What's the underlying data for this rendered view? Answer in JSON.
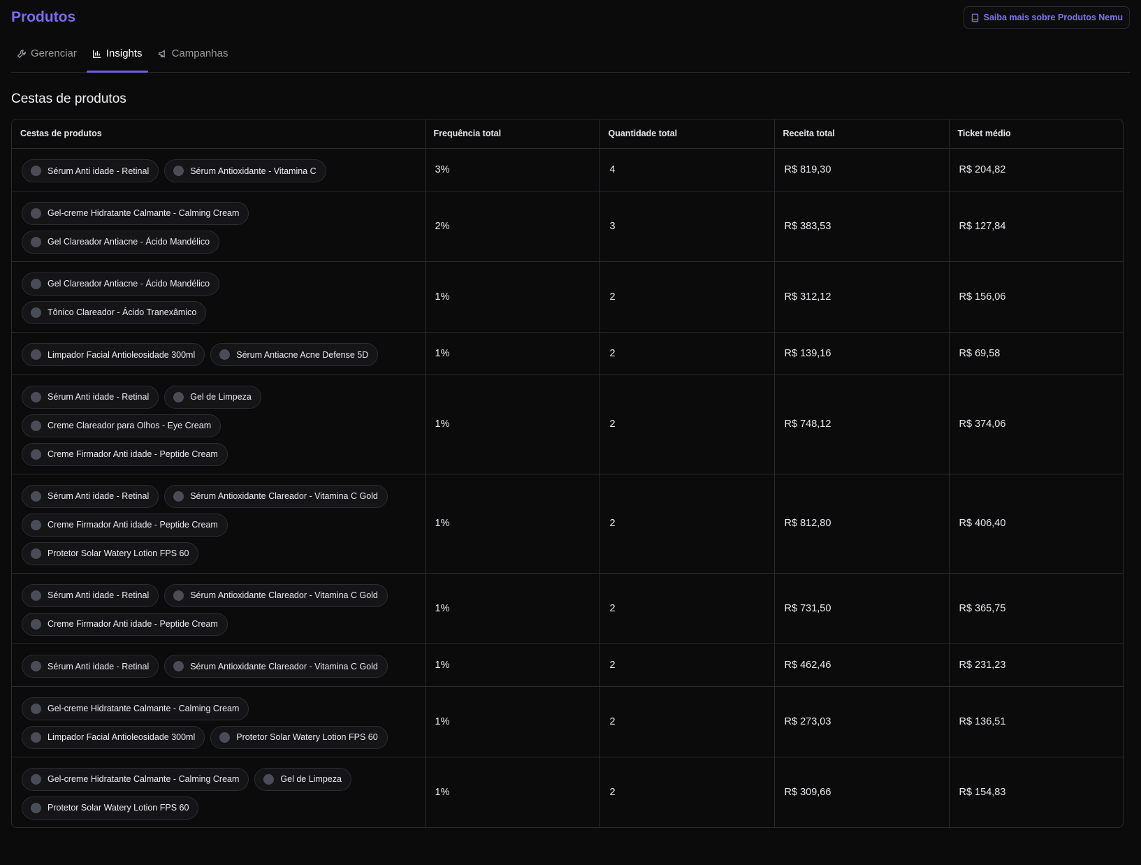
{
  "header": {
    "title": "Produtos",
    "learn_more": "Saiba mais sobre Produtos Nemu"
  },
  "tabs": [
    {
      "label": "Gerenciar",
      "icon": "wrench-icon",
      "active": false
    },
    {
      "label": "Insights",
      "icon": "bar-chart-icon",
      "active": true
    },
    {
      "label": "Campanhas",
      "icon": "megaphone-icon",
      "active": false
    }
  ],
  "section": {
    "title": "Cestas de produtos"
  },
  "colors": {
    "accent": "#7b6cf0",
    "background": "#0b0b0c",
    "border": "#2a2a2f"
  },
  "table": {
    "columns": [
      "Cestas de produtos",
      "Frequência total",
      "Quantidade total",
      "Receita total",
      "Ticket médio"
    ],
    "rows": [
      {
        "products": [
          "Sérum Anti idade - Retinal",
          "Sérum Antioxidante - Vitamina C"
        ],
        "freq": "3%",
        "qty": "4",
        "revenue": "R$ 819,30",
        "ticket": "R$ 204,82"
      },
      {
        "products": [
          "Gel-creme Hidratante Calmante - Calming Cream",
          "Gel Clareador Antiacne - Ácido Mandélico"
        ],
        "freq": "2%",
        "qty": "3",
        "revenue": "R$ 383,53",
        "ticket": "R$ 127,84"
      },
      {
        "products": [
          "Gel Clareador Antiacne - Ácido Mandélico",
          "Tônico Clareador - Ácido Tranexâmico"
        ],
        "freq": "1%",
        "qty": "2",
        "revenue": "R$ 312,12",
        "ticket": "R$ 156,06"
      },
      {
        "products": [
          "Limpador Facial Antioleosidade 300ml",
          "Sérum Antiacne Acne Defense 5D"
        ],
        "freq": "1%",
        "qty": "2",
        "revenue": "R$ 139,16",
        "ticket": "R$ 69,58"
      },
      {
        "products": [
          "Sérum Anti idade - Retinal",
          "Gel de Limpeza",
          "Creme Clareador para Olhos - Eye Cream",
          "Creme Firmador Anti idade - Peptide Cream"
        ],
        "freq": "1%",
        "qty": "2",
        "revenue": "R$ 748,12",
        "ticket": "R$ 374,06"
      },
      {
        "products": [
          "Sérum Anti idade - Retinal",
          "Sérum Antioxidante Clareador - Vitamina C Gold",
          "Creme Firmador Anti idade - Peptide Cream",
          "Protetor Solar Watery Lotion FPS 60"
        ],
        "freq": "1%",
        "qty": "2",
        "revenue": "R$ 812,80",
        "ticket": "R$ 406,40"
      },
      {
        "products": [
          "Sérum Anti idade - Retinal",
          "Sérum Antioxidante Clareador - Vitamina C Gold",
          "Creme Firmador Anti idade - Peptide Cream"
        ],
        "freq": "1%",
        "qty": "2",
        "revenue": "R$ 731,50",
        "ticket": "R$ 365,75"
      },
      {
        "products": [
          "Sérum Anti idade - Retinal",
          "Sérum Antioxidante Clareador - Vitamina C Gold"
        ],
        "freq": "1%",
        "qty": "2",
        "revenue": "R$ 462,46",
        "ticket": "R$ 231,23"
      },
      {
        "products": [
          "Gel-creme Hidratante Calmante - Calming Cream",
          "Limpador Facial Antioleosidade 300ml",
          "Protetor Solar Watery Lotion FPS 60"
        ],
        "freq": "1%",
        "qty": "2",
        "revenue": "R$ 273,03",
        "ticket": "R$ 136,51"
      },
      {
        "products": [
          "Gel-creme Hidratante Calmante - Calming Cream",
          "Gel de Limpeza",
          "Protetor Solar Watery Lotion FPS 60"
        ],
        "freq": "1%",
        "qty": "2",
        "revenue": "R$ 309,66",
        "ticket": "R$ 154,83"
      }
    ]
  }
}
